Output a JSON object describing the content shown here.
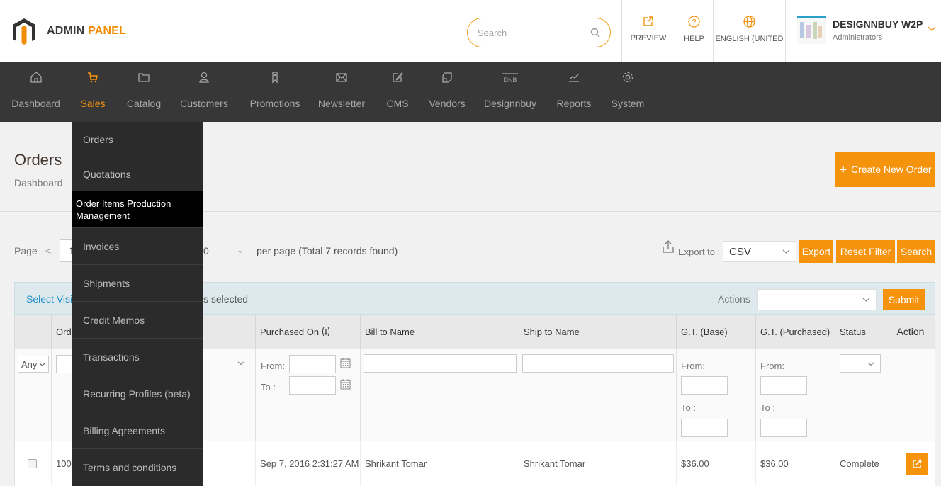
{
  "header": {
    "brand_prefix": "ADMIN",
    "brand_suffix": "PANEL",
    "search_placeholder": "Search",
    "buttons": {
      "preview": "PREVIEW",
      "help": "HELP",
      "language": "ENGLISH (UNITED S"
    },
    "user": {
      "name": "DESIGNNBUY W2P",
      "role": "Administrators"
    }
  },
  "nav": {
    "items": [
      {
        "label": "Dashboard",
        "icon": "home-icon"
      },
      {
        "label": "Sales",
        "icon": "cart-icon"
      },
      {
        "label": "Catalog",
        "icon": "folder-icon"
      },
      {
        "label": "Customers",
        "icon": "user-icon"
      },
      {
        "label": "Promotions",
        "icon": "tag-icon"
      },
      {
        "label": "Newsletter",
        "icon": "mail-icon"
      },
      {
        "label": "CMS",
        "icon": "edit-icon"
      },
      {
        "label": "Vendors",
        "icon": "vendors-icon"
      },
      {
        "label": "Designnbuy",
        "icon": "dnb-icon"
      },
      {
        "label": "Reports",
        "icon": "chart-icon"
      },
      {
        "label": "System",
        "icon": "gear-icon"
      }
    ],
    "active": "Sales",
    "dnb_text": "DNB"
  },
  "sales_menu": {
    "items": [
      "Orders",
      "Quotations",
      "Order Items Production Management",
      "Invoices",
      "Shipments",
      "Credit Memos",
      "Transactions",
      "Recurring Profiles (beta)",
      "Billing Agreements",
      "Terms and conditions"
    ],
    "active": "Order Items Production Management"
  },
  "page": {
    "title": "Orders",
    "breadcrumb": "Dashboard",
    "create_button": "Create New Order"
  },
  "pager": {
    "label": "Page",
    "prev": "<",
    "page_partial": "1",
    "limit_partial": "0",
    "total_text": "per page (Total 7 records found)",
    "export_label": "Export to :",
    "export_format": "CSV",
    "export_button": "Export",
    "reset_button": "Reset Filter",
    "search_button": "Search"
  },
  "massaction": {
    "select_visible": "Select Visib",
    "selected_text": "s selected",
    "actions_label": "Actions",
    "submit": "Submit"
  },
  "grid": {
    "headers": {
      "order_partial": "Orde",
      "purchased_on": "Purchased On",
      "bill_to": "Bill to Name",
      "ship_to": "Ship to Name",
      "gt_base": "G.T. (Base)",
      "gt_purchased": "G.T. (Purchased)",
      "status": "Status",
      "action": "Action"
    },
    "filters": {
      "any": "Any",
      "from": "From:",
      "to": "To :",
      "gt_to": "To :"
    },
    "rows": [
      {
        "order_partial": "100",
        "purchased_on": "Sep 7, 2016 2:31:27 AM",
        "bill_to": "Shrikant Tomar",
        "ship_to": "Shrikant Tomar",
        "gt_base": "$36.00",
        "gt_purchased": "$36.00",
        "status": "Complete"
      }
    ]
  },
  "colors": {
    "accent": "#f5930c",
    "nav_bg": "#373737",
    "menu_bg": "#2b2b2b",
    "link": "#1f8fc5"
  }
}
